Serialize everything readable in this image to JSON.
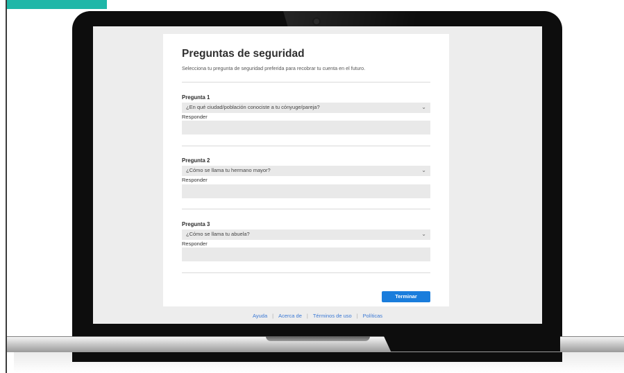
{
  "page": {
    "title": "Preguntas de seguridad",
    "subtitle": "Selecciona tu pregunta de seguridad preferida para recobrar tu cuenta en el futuro."
  },
  "questions": [
    {
      "label": "Pregunta 1",
      "selected": "¿En qué ciudad/población conociste a tu cónyuge/pareja?",
      "answer_label": "Responder",
      "answer_value": ""
    },
    {
      "label": "Pregunta 2",
      "selected": "¿Cómo se llama tu hermano mayor?",
      "answer_label": "Responder",
      "answer_value": ""
    },
    {
      "label": "Pregunta 3",
      "selected": "¿Cómo se llama tu abuela?",
      "answer_label": "Responder",
      "answer_value": ""
    }
  ],
  "actions": {
    "finish_label": "Terminar"
  },
  "footer": {
    "links": [
      "Ayuda",
      "Acerca de",
      "Términos de uso",
      "Políticas"
    ],
    "separator": "|"
  },
  "icons": {
    "dropdown": "chevron-down-icon",
    "camera": "webcam-icon"
  },
  "colors": {
    "accent": "#1a7ddc",
    "link": "#3a78d4",
    "teal_tab": "#1fb7a8",
    "field_bg": "#e9e9e9"
  }
}
